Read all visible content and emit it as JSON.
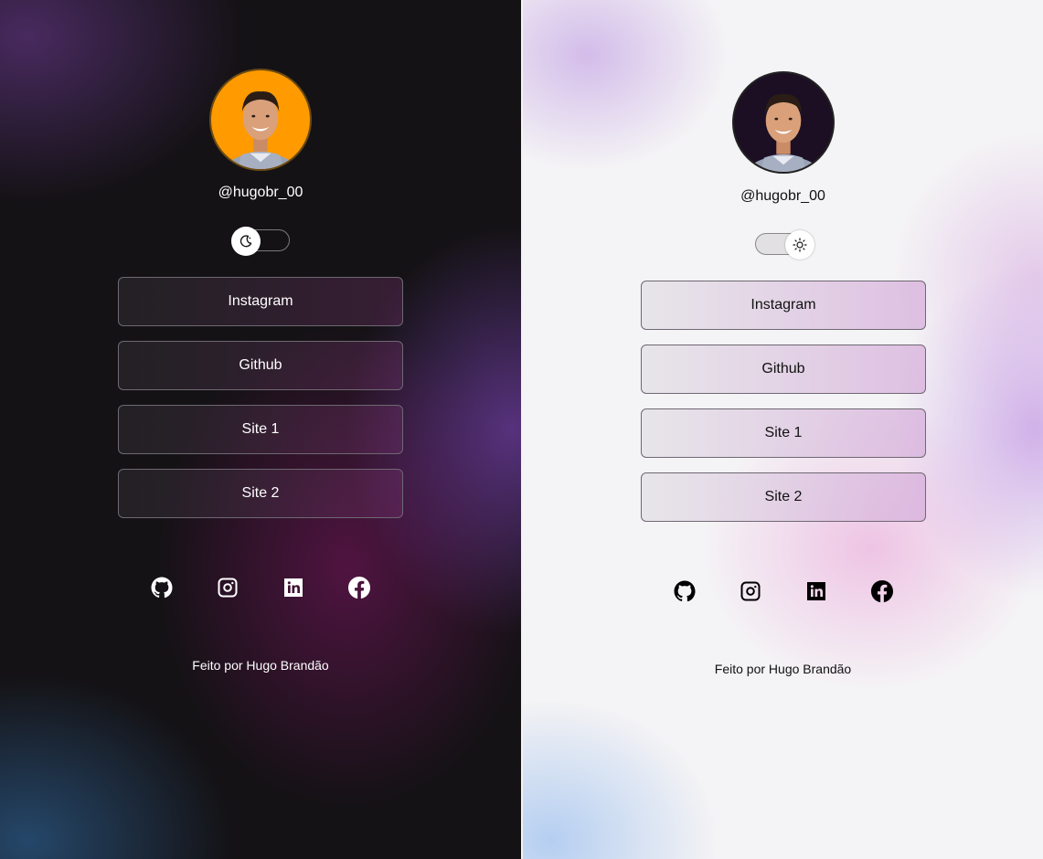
{
  "themes": {
    "dark": {
      "username": "@hugobr_00",
      "toggle_mode": "dark",
      "links": [
        "Instagram",
        "Github",
        "Site 1",
        "Site 2"
      ],
      "socials": [
        "github-icon",
        "instagram-icon",
        "linkedin-icon",
        "facebook-icon"
      ],
      "footer": "Feito por Hugo Brandão",
      "colors": {
        "background": "#141215",
        "avatar_bg": "#ff9a00",
        "text": "#ffffff"
      }
    },
    "light": {
      "username": "@hugobr_00",
      "toggle_mode": "light",
      "links": [
        "Instagram",
        "Github",
        "Site 1",
        "Site 2"
      ],
      "socials": [
        "github-icon",
        "instagram-icon",
        "linkedin-icon",
        "facebook-icon"
      ],
      "footer": "Feito por Hugo Brandão",
      "colors": {
        "background": "#f4f3f5",
        "avatar_bg": "#1c0f24",
        "text": "#111111"
      }
    }
  }
}
